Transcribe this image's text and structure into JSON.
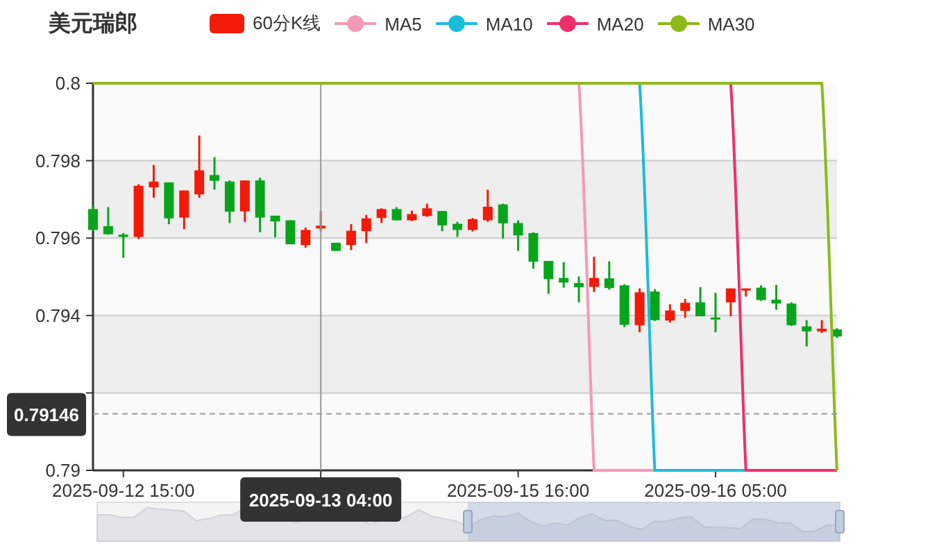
{
  "title": "美元瑞郎",
  "legend": [
    {
      "label": "60分K线",
      "kind": "candle",
      "color": "#f21a08"
    },
    {
      "label": "MA5",
      "kind": "line",
      "color": "#f59ab6"
    },
    {
      "label": "MA10",
      "kind": "line",
      "color": "#1bbcd9"
    },
    {
      "label": "MA20",
      "kind": "line",
      "color": "#ee2f6b"
    },
    {
      "label": "MA30",
      "kind": "line",
      "color": "#8fb81a"
    }
  ],
  "chart_data": {
    "type": "candlestick",
    "ylim": [
      0.79,
      0.8
    ],
    "yticks": [
      0.79,
      0.794,
      0.796,
      0.798,
      0.8
    ],
    "grid": true,
    "categories": [
      null,
      null,
      "2025-09-12 15:00",
      null,
      null,
      null,
      null,
      null,
      null,
      null,
      null,
      null,
      null,
      null,
      null,
      null,
      null,
      null,
      null,
      null,
      null,
      null,
      null,
      null,
      null,
      null,
      null,
      null,
      "2025-09-15 16:00",
      null,
      null,
      null,
      null,
      null,
      null,
      null,
      null,
      null,
      null,
      null,
      null,
      "2025-09-16 05:00",
      null,
      null,
      null,
      null,
      null,
      null,
      null,
      null
    ],
    "ohlc": [
      [
        0.79675,
        0.79686,
        0.79619,
        0.79621
      ],
      [
        0.79631,
        0.7968,
        0.79609,
        0.7961
      ],
      [
        0.79609,
        0.79613,
        0.79549,
        0.79603
      ],
      [
        0.79603,
        0.79739,
        0.79598,
        0.79735
      ],
      [
        0.79731,
        0.79789,
        0.79704,
        0.79746
      ],
      [
        0.79744,
        0.79744,
        0.79636,
        0.79651
      ],
      [
        0.79653,
        0.79723,
        0.79623,
        0.79723
      ],
      [
        0.79713,
        0.79865,
        0.79704,
        0.79775
      ],
      [
        0.79763,
        0.79809,
        0.79725,
        0.79748
      ],
      [
        0.79746,
        0.79749,
        0.79639,
        0.79668
      ],
      [
        0.79669,
        0.79749,
        0.79642,
        0.79749
      ],
      [
        0.79749,
        0.79756,
        0.79615,
        0.79653
      ],
      [
        0.79658,
        0.79658,
        0.79602,
        0.79643
      ],
      [
        0.79646,
        0.79646,
        0.79584,
        0.79584
      ],
      [
        0.79582,
        0.79627,
        0.79575,
        0.79621
      ],
      [
        0.79625,
        0.7967,
        0.79618,
        0.79632
      ],
      [
        0.79588,
        0.79588,
        0.79567,
        0.79567
      ],
      [
        0.79582,
        0.79636,
        0.79569,
        0.79619
      ],
      [
        0.79618,
        0.7966,
        0.79587,
        0.79651
      ],
      [
        0.79652,
        0.79677,
        0.79639,
        0.79675
      ],
      [
        0.79675,
        0.7968,
        0.79646,
        0.79646
      ],
      [
        0.79646,
        0.79671,
        0.79644,
        0.79662
      ],
      [
        0.79657,
        0.79689,
        0.79655,
        0.79677
      ],
      [
        0.7967,
        0.7967,
        0.79618,
        0.79633
      ],
      [
        0.79637,
        0.79642,
        0.79603,
        0.79621
      ],
      [
        0.79621,
        0.79652,
        0.79617,
        0.79649
      ],
      [
        0.79646,
        0.79725,
        0.79642,
        0.79681
      ],
      [
        0.79687,
        0.79689,
        0.79599,
        0.79638
      ],
      [
        0.79639,
        0.79646,
        0.79567,
        0.79607
      ],
      [
        0.79613,
        0.79615,
        0.79521,
        0.79539
      ],
      [
        0.79541,
        0.79541,
        0.79456,
        0.79494
      ],
      [
        0.79497,
        0.79538,
        0.79472,
        0.79485
      ],
      [
        0.79484,
        0.79501,
        0.79434,
        0.79473
      ],
      [
        0.79474,
        0.79552,
        0.79461,
        0.79497
      ],
      [
        0.79496,
        0.7954,
        0.79467,
        0.79471
      ],
      [
        0.79478,
        0.79481,
        0.7937,
        0.79376
      ],
      [
        0.79375,
        0.7947,
        0.79357,
        0.7946
      ],
      [
        0.79462,
        0.79468,
        0.79386,
        0.79388
      ],
      [
        0.79387,
        0.79429,
        0.79382,
        0.79413
      ],
      [
        0.79412,
        0.79443,
        0.79394,
        0.79433
      ],
      [
        0.79434,
        0.79473,
        0.79398,
        0.79398
      ],
      [
        0.79395,
        0.79459,
        0.79357,
        0.79392
      ],
      [
        0.79434,
        0.7947,
        0.79398,
        0.7947
      ],
      [
        0.79466,
        0.7947,
        0.79449,
        0.7947
      ],
      [
        0.79472,
        0.79478,
        0.79438,
        0.7944
      ],
      [
        0.79441,
        0.79479,
        0.79415,
        0.79431
      ],
      [
        0.79431,
        0.79434,
        0.79373,
        0.79375
      ],
      [
        0.79372,
        0.79388,
        0.7932,
        0.79359
      ],
      [
        0.79359,
        0.79388,
        0.79355,
        0.79366
      ],
      [
        0.79364,
        0.79367,
        0.79342,
        0.79346
      ]
    ]
  },
  "crosshair": {
    "time": "2025-09-13 04:00",
    "price": "0.79146"
  }
}
